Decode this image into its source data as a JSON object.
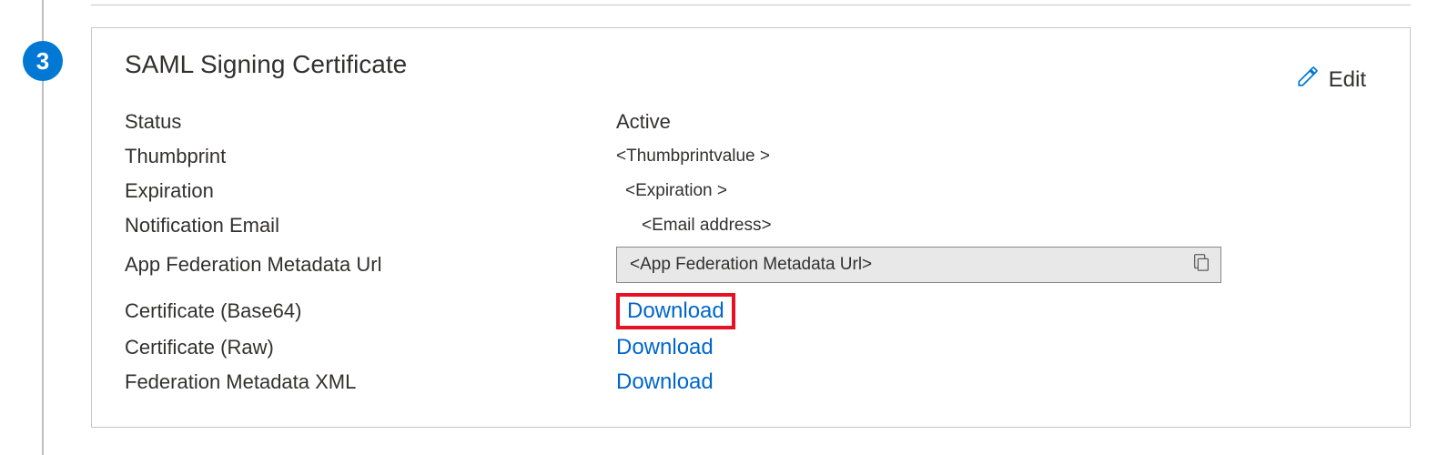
{
  "step": {
    "number": "3"
  },
  "card": {
    "title": "SAML Signing Certificate",
    "edit_label": "Edit"
  },
  "labels": {
    "status": "Status",
    "thumbprint": "Thumbprint",
    "expiration": "Expiration",
    "notification_email": "Notification Email",
    "app_fed_url": "App Federation Metadata Url",
    "cert_base64": "Certificate (Base64)",
    "cert_raw": "Certificate (Raw)",
    "fed_xml": "Federation Metadata XML"
  },
  "values": {
    "status": "Active",
    "thumbprint": "<Thumbprintvalue >",
    "expiration": "<Expiration >",
    "notification_email": "<Email address>",
    "app_fed_url": "<App Federation  Metadata Url>"
  },
  "actions": {
    "download": "Download"
  }
}
